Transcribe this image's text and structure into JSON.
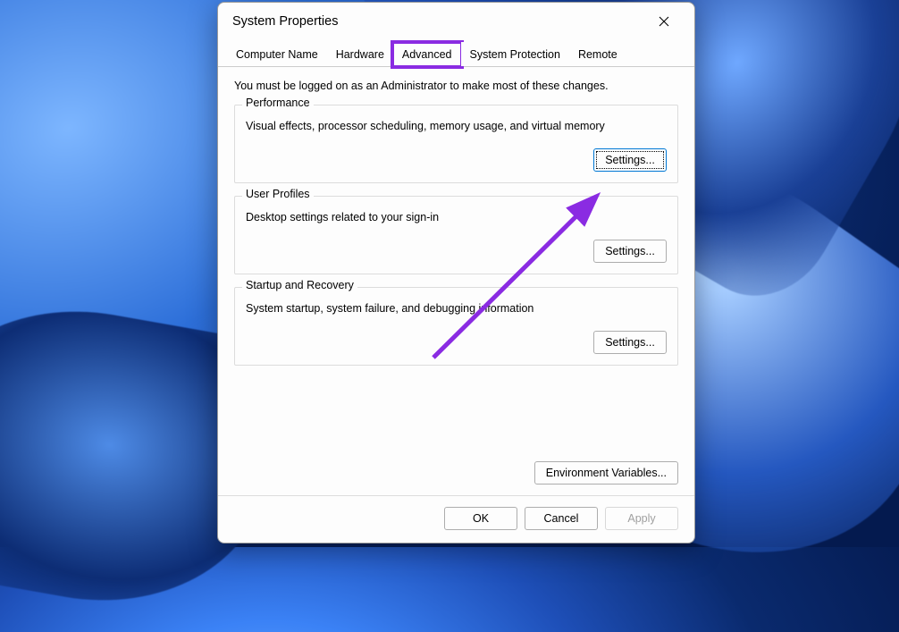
{
  "dialog": {
    "title": "System Properties",
    "tabs": [
      {
        "label": "Computer Name"
      },
      {
        "label": "Hardware"
      },
      {
        "label": "Advanced"
      },
      {
        "label": "System Protection"
      },
      {
        "label": "Remote"
      }
    ],
    "active_tab_index": 2,
    "admin_notice": "You must be logged on as an Administrator to make most of these changes.",
    "groups": {
      "performance": {
        "legend": "Performance",
        "desc": "Visual effects, processor scheduling, memory usage, and virtual memory",
        "button": "Settings..."
      },
      "user_profiles": {
        "legend": "User Profiles",
        "desc": "Desktop settings related to your sign-in",
        "button": "Settings..."
      },
      "startup": {
        "legend": "Startup and Recovery",
        "desc": "System startup, system failure, and debugging information",
        "button": "Settings..."
      }
    },
    "env_button": "Environment Variables...",
    "footer": {
      "ok": "OK",
      "cancel": "Cancel",
      "apply": "Apply"
    }
  },
  "annotation": {
    "highlight_color": "#8a2be2"
  }
}
